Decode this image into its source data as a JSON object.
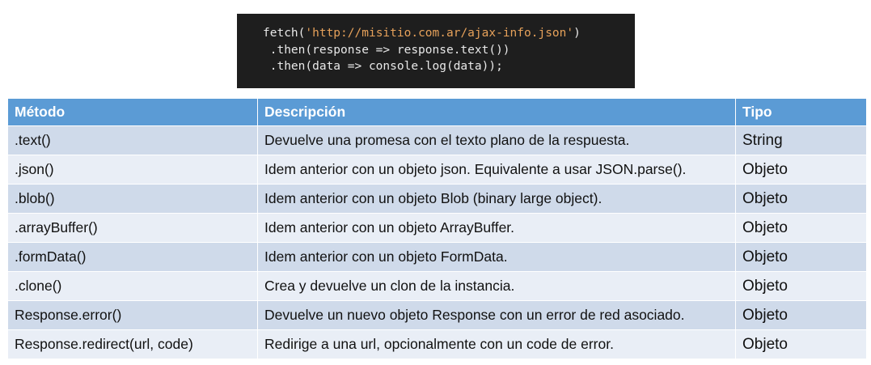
{
  "code": {
    "line1_prefix": "fetch(",
    "line1_string": "'http://misitio.com.ar/ajax-info.json'",
    "line1_suffix": ")",
    "line2": " .then(response => response.text())",
    "line3": " .then(data => console.log(data));"
  },
  "table": {
    "headers": {
      "method": "Método",
      "description": "Descripción",
      "type": "Tipo"
    },
    "rows": [
      {
        "method": ".text()",
        "description": "Devuelve una promesa con el texto plano de la respuesta.",
        "type": "String"
      },
      {
        "method": ".json()",
        "description": "Idem anterior con un objeto json. Equivalente a usar JSON.parse().",
        "type": "Objeto"
      },
      {
        "method": ".blob()",
        "description": "Idem anterior con un objeto Blob (binary large object).",
        "type": "Objeto"
      },
      {
        "method": ".arrayBuffer()",
        "description": "Idem anterior con un objeto ArrayBuffer.",
        "type": "Objeto"
      },
      {
        "method": ".formData()",
        "description": "Idem anterior con un objeto FormData.",
        "type": "Objeto"
      },
      {
        "method": ".clone()",
        "description": "Crea y devuelve un clon de la instancia.",
        "type": "Objeto"
      },
      {
        "method": "Response.error()",
        "description": "Devuelve un nuevo objeto Response con un error de red asociado.",
        "type": "Objeto"
      },
      {
        "method": "Response.redirect(url, code)",
        "description": "Redirige a una url, opcionalmente con un code de error.",
        "type": "Objeto"
      }
    ]
  }
}
